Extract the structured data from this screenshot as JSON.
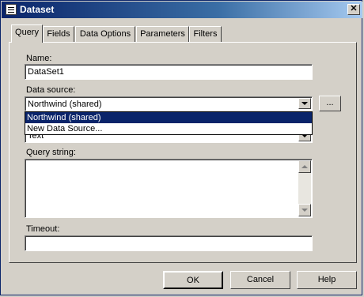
{
  "window": {
    "title": "Dataset",
    "close_glyph": "✕"
  },
  "tabs": [
    {
      "label": "Query"
    },
    {
      "label": "Fields"
    },
    {
      "label": "Data Options"
    },
    {
      "label": "Parameters"
    },
    {
      "label": "Filters"
    }
  ],
  "form": {
    "name_label": "Name:",
    "name_value": "DataSet1",
    "data_source_label": "Data source:",
    "data_source_value": "Northwind (shared)",
    "data_source_options": [
      "Northwind (shared)",
      "New Data Source..."
    ],
    "ellipsis_label": "...",
    "command_type_value": "Text",
    "query_string_label": "Query string:",
    "query_string_value": "",
    "timeout_label": "Timeout:",
    "timeout_value": ""
  },
  "buttons": {
    "ok": "OK",
    "cancel": "Cancel",
    "help": "Help"
  }
}
